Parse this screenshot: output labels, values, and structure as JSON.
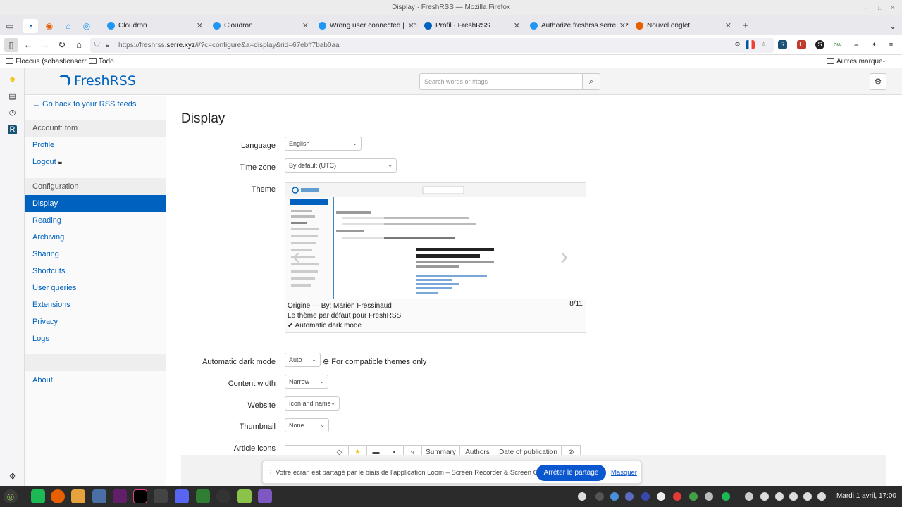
{
  "window": {
    "title": "Display · FreshRSS — Mozilla Firefox"
  },
  "tabs": [
    {
      "label": "Cloudron",
      "color": "#2196f3"
    },
    {
      "label": "Cloudron",
      "color": "#2196f3"
    },
    {
      "label": "Wrong user connected | Clo",
      "color": "#2196f3"
    },
    {
      "label": "Profil · FreshRSS",
      "color": "#0062be"
    },
    {
      "label": "Authorize freshrss.serre.xyz",
      "color": "#2196f3"
    },
    {
      "label": "Nouvel onglet",
      "color": "#e66000"
    }
  ],
  "url": {
    "prefix": "https://freshrss.",
    "domain": "serre.xyz",
    "suffix": "/i/?c=configure&a=display&rid=67ebff7bab0aa"
  },
  "bookmarks": {
    "item1": "Floccus (sebastienserr...",
    "item2": "Todo",
    "other": "Autres marque-pages"
  },
  "header": {
    "logo": "FreshRSS",
    "search_placeholder": "Search words or #tags"
  },
  "sidebar": {
    "back": "← Go back to your RSS feeds",
    "account_head": "Account: tom",
    "profile": "Profile",
    "logout": "Logout",
    "config_head": "Configuration",
    "items": [
      "Display",
      "Reading",
      "Archiving",
      "Sharing",
      "Shortcuts",
      "User queries",
      "Extensions",
      "Privacy",
      "Logs"
    ],
    "about": "About"
  },
  "main": {
    "title": "Display",
    "language": {
      "label": "Language",
      "value": "English"
    },
    "timezone": {
      "label": "Time zone",
      "value": "By default (UTC)"
    },
    "theme": {
      "label": "Theme",
      "origin": "Origine — By: Marien Fressinaud",
      "description": "Le thème par défaut pour FreshRSS",
      "feature": "✔ Automatic dark mode",
      "index": "8/11"
    },
    "darkmode": {
      "label": "Automatic dark mode",
      "value": "Auto",
      "hint": "For compatible themes only"
    },
    "content_width": {
      "label": "Content width",
      "value": "Narrow"
    },
    "website": {
      "label": "Website",
      "value": "Icon and name"
    },
    "thumbnail": {
      "label": "Thumbnail",
      "value": "None"
    },
    "article_icons": {
      "label": "Article icons",
      "cols": [
        "Summary",
        "Authors",
        "Date of publication"
      ]
    }
  },
  "loom": {
    "text": "Votre écran est partagé par le biais de l'application Loom – Screen Recorder & Screen Capture.",
    "stop": "Arrêter le partage",
    "hide": "Masquer"
  },
  "taskbar": {
    "clock": "Mardi 1 avril, 17:00"
  }
}
